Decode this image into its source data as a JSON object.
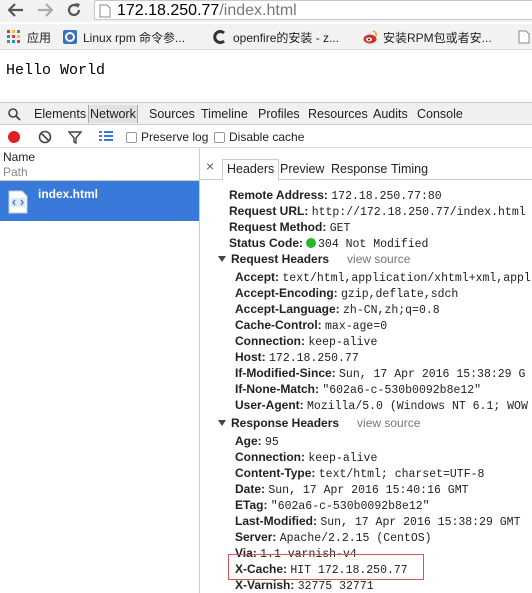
{
  "browser": {
    "url_host": "172.18.250.77",
    "url_path": "/index.html",
    "bookmarks": [
      {
        "label": "应用",
        "icon": "apps-grid-icon"
      },
      {
        "label": "Linux rpm 命令参...",
        "icon": "bookmark-page-icon"
      },
      {
        "label": "openfire的安装 - z...",
        "icon": "c-logo-icon"
      },
      {
        "label": "安装RPM包或者安...",
        "icon": "weibo-logo-icon"
      }
    ]
  },
  "page": {
    "text": "Hello World"
  },
  "devtools": {
    "tabs": [
      "Elements",
      "Network",
      "Sources",
      "Timeline",
      "Profiles",
      "Resources",
      "Audits",
      "Console"
    ],
    "active_tab": "Network",
    "network_toolbar": {
      "preserve_log": "Preserve log",
      "disable_cache": "Disable cache"
    },
    "request_list": {
      "col_name": "Name",
      "col_path": "Path",
      "rows": [
        {
          "name": "index.html"
        }
      ]
    },
    "detail_tabs": [
      "Headers",
      "Preview",
      "Response",
      "Timing"
    ],
    "active_detail_tab": "Headers",
    "general": [
      {
        "k": "Remote Address:",
        "v": "172.18.250.77:80"
      },
      {
        "k": "Request URL:",
        "v": "http://172.18.250.77/index.html"
      },
      {
        "k": "Request Method:",
        "v": "GET"
      },
      {
        "k": "Status Code:",
        "v": "304 Not Modified"
      }
    ],
    "request_headers_title": "Request Headers",
    "view_source": "view source",
    "request_headers": [
      {
        "k": "Accept:",
        "v": "text/html,application/xhtml+xml,appl"
      },
      {
        "k": "Accept-Encoding:",
        "v": "gzip,deflate,sdch"
      },
      {
        "k": "Accept-Language:",
        "v": "zh-CN,zh;q=0.8"
      },
      {
        "k": "Cache-Control:",
        "v": "max-age=0"
      },
      {
        "k": "Connection:",
        "v": "keep-alive"
      },
      {
        "k": "Host:",
        "v": "172.18.250.77"
      },
      {
        "k": "If-Modified-Since:",
        "v": "Sun, 17 Apr 2016 15:38:29 G"
      },
      {
        "k": "If-None-Match:",
        "v": "\"602a6-c-530b0092b8e12\""
      },
      {
        "k": "User-Agent:",
        "v": "Mozilla/5.0 (Windows NT 6.1; WOW"
      }
    ],
    "response_headers_title": "Response Headers",
    "response_headers": [
      {
        "k": "Age:",
        "v": "95"
      },
      {
        "k": "Connection:",
        "v": "keep-alive"
      },
      {
        "k": "Content-Type:",
        "v": "text/html; charset=UTF-8"
      },
      {
        "k": "Date:",
        "v": "Sun, 17 Apr 2016 15:40:16 GMT"
      },
      {
        "k": "ETag:",
        "v": "\"602a6-c-530b0092b8e12\""
      },
      {
        "k": "Last-Modified:",
        "v": "Sun, 17 Apr 2016 15:38:29 GMT"
      },
      {
        "k": "Server:",
        "v": "Apache/2.2.15 (CentOS)"
      },
      {
        "k": "Via:",
        "v": "1.1 varnish-v4"
      },
      {
        "k": "X-Cache:",
        "v": "HIT 172.18.250.77"
      },
      {
        "k": "X-Varnish:",
        "v": "32775 32771"
      }
    ],
    "colors": {
      "selected_row": "#3879d9",
      "status_ok": "#2bb52b",
      "record": "#e02020",
      "highlight": "#e0505a"
    }
  }
}
